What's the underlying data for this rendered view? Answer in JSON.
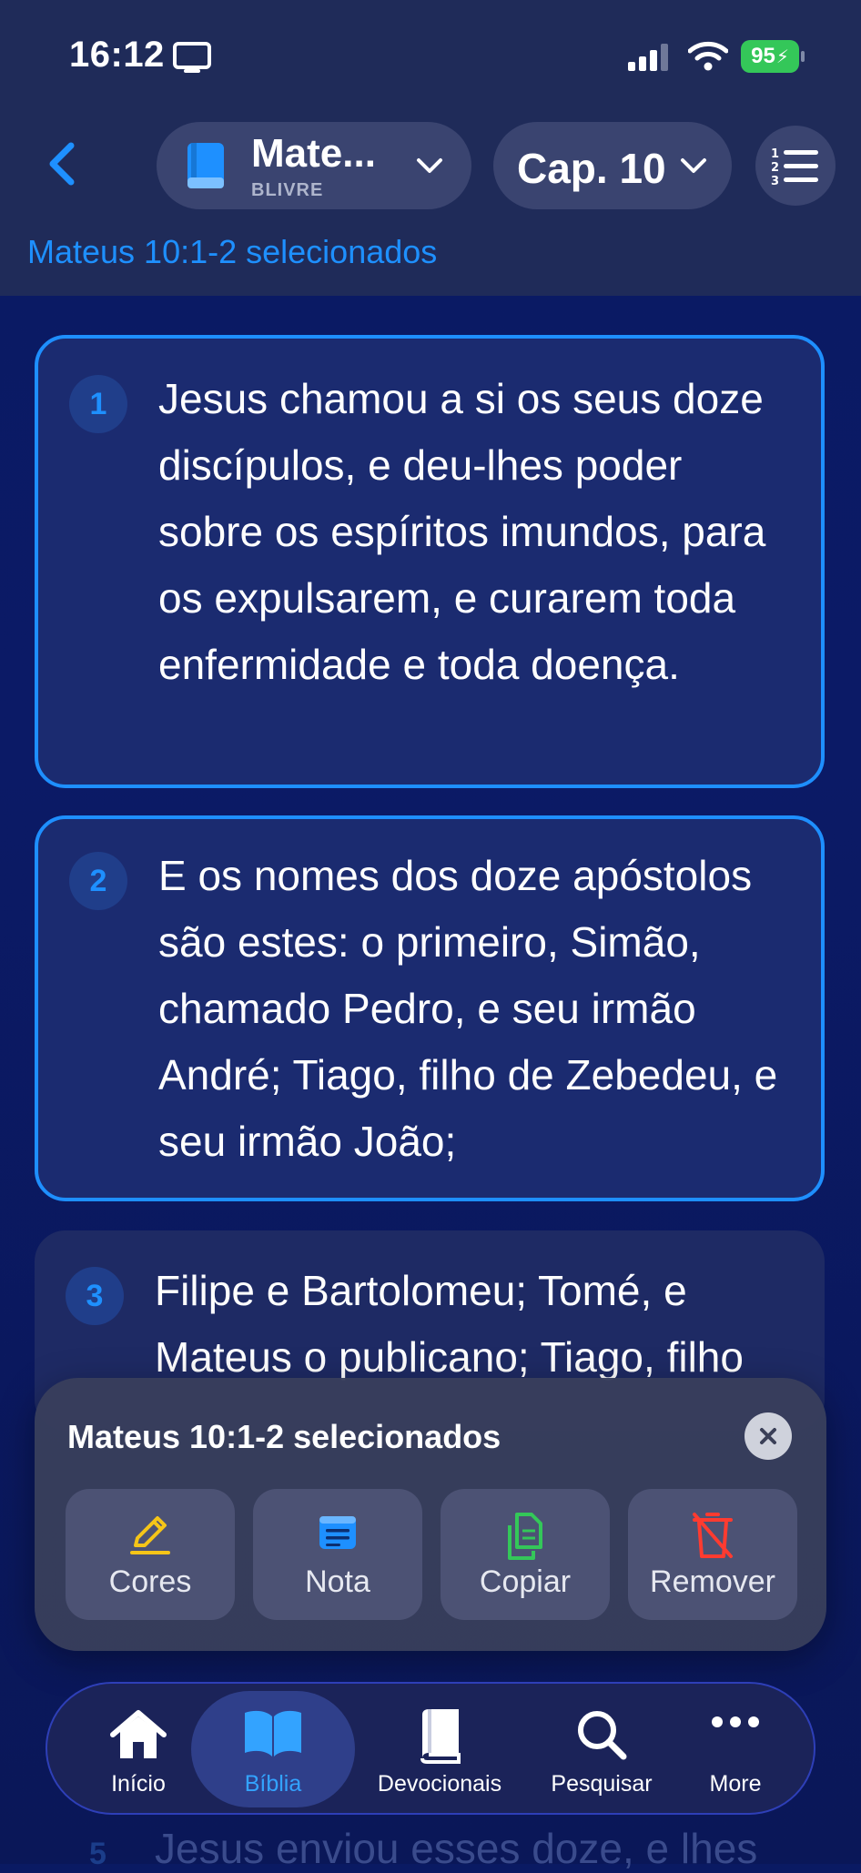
{
  "status": {
    "time": "16:12",
    "battery": "95"
  },
  "header": {
    "book_title": "Mate...",
    "book_version": "BLIVRE",
    "chapter": "Cap. 10",
    "selection_banner": "Mateus 10:1-2 selecionados"
  },
  "verses": [
    {
      "num": "1",
      "text": "Jesus chamou a si os seus doze discípulos, e deu-lhes poder sobre os espíritos imundos, para os expulsarem, e curarem toda enfermidade e toda doença."
    },
    {
      "num": "2",
      "text": "E os nomes dos doze apóstolos são estes: o primeiro, Simão, chamado Pedro, e seu irmão André; Tiago, filho de Zebedeu, e seu irmão João;"
    },
    {
      "num": "3",
      "text": "Filipe e Bartolomeu; Tomé, e Mateus o publicano; Tiago, filho"
    }
  ],
  "peek": {
    "num": "5",
    "text": "Jesus enviou esses doze, e lhes"
  },
  "sheet": {
    "title": "Mateus 10:1-2 selecionados",
    "actions": [
      {
        "label": "Cores",
        "icon": "pencil-icon",
        "color": "#f5c518"
      },
      {
        "label": "Nota",
        "icon": "note-icon",
        "color": "#1e90ff"
      },
      {
        "label": "Copiar",
        "icon": "copy-icon",
        "color": "#34c759"
      },
      {
        "label": "Remover",
        "icon": "trash-icon",
        "color": "#ff3b30"
      }
    ]
  },
  "tabs": [
    {
      "label": "Início",
      "icon": "home-icon"
    },
    {
      "label": "Bíblia",
      "icon": "bible-icon",
      "active": true
    },
    {
      "label": "Devocionais",
      "icon": "book-icon"
    },
    {
      "label": "Pesquisar",
      "icon": "search-icon"
    },
    {
      "label": "More",
      "icon": "more-icon"
    }
  ]
}
